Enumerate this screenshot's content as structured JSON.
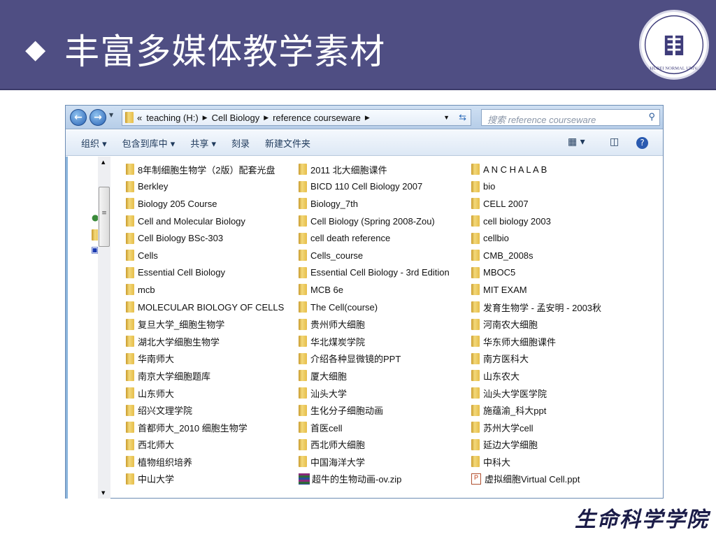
{
  "slide": {
    "bullet_icon": "diamond",
    "title": "丰富多媒体教学素材",
    "logo_text": "湖北师范学院 HUBEI NORMAL UNIVERSITY",
    "footer": "生命科学学院"
  },
  "explorer": {
    "address": [
      "«",
      "teaching (H:)",
      "Cell Biology",
      "reference courseware"
    ],
    "search_placeholder": "搜索 reference courseware",
    "toolbar": [
      "组织 ▾",
      "包含到库中 ▾",
      "共享 ▾",
      "刻录",
      "新建文件夹"
    ],
    "items": [
      {
        "name": "8年制细胞生物学（2版）配套光盘",
        "type": "folder"
      },
      {
        "name": "2011 北大细胞课件",
        "type": "folder"
      },
      {
        "name": "A N C H A   L A B",
        "type": "folder"
      },
      {
        "name": "Berkley",
        "type": "folder"
      },
      {
        "name": "BICD 110 Cell Biology 2007",
        "type": "folder"
      },
      {
        "name": "bio",
        "type": "folder"
      },
      {
        "name": "Biology 205 Course",
        "type": "folder"
      },
      {
        "name": "Biology_7th",
        "type": "folder"
      },
      {
        "name": "CELL 2007",
        "type": "folder"
      },
      {
        "name": "Cell and Molecular Biology",
        "type": "folder"
      },
      {
        "name": "Cell Biology (Spring 2008-Zou)",
        "type": "folder"
      },
      {
        "name": "cell biology 2003",
        "type": "folder"
      },
      {
        "name": "Cell Biology BSc-303",
        "type": "folder"
      },
      {
        "name": "cell death reference",
        "type": "folder"
      },
      {
        "name": "cellbio",
        "type": "folder"
      },
      {
        "name": "Cells",
        "type": "folder"
      },
      {
        "name": "Cells_course",
        "type": "folder"
      },
      {
        "name": "CMB_2008s",
        "type": "folder"
      },
      {
        "name": "Essential Cell Biology",
        "type": "folder"
      },
      {
        "name": "Essential Cell Biology - 3rd Edition",
        "type": "folder"
      },
      {
        "name": "MBOC5",
        "type": "folder"
      },
      {
        "name": "mcb",
        "type": "folder"
      },
      {
        "name": "MCB 6e",
        "type": "folder"
      },
      {
        "name": "MIT EXAM",
        "type": "folder"
      },
      {
        "name": "MOLECULAR BIOLOGY OF CELLS",
        "type": "folder"
      },
      {
        "name": "The Cell(course)",
        "type": "folder"
      },
      {
        "name": "发育生物学 - 孟安明 - 2003秋",
        "type": "folder"
      },
      {
        "name": "复旦大学_细胞生物学",
        "type": "folder"
      },
      {
        "name": "贵州师大细胞",
        "type": "folder"
      },
      {
        "name": "河南农大细胞",
        "type": "folder"
      },
      {
        "name": "湖北大学细胞生物学",
        "type": "folder"
      },
      {
        "name": "华北煤炭学院",
        "type": "folder"
      },
      {
        "name": "华东师大细胞课件",
        "type": "folder"
      },
      {
        "name": "华南师大",
        "type": "folder"
      },
      {
        "name": "介绍各种显微镜的PPT",
        "type": "folder"
      },
      {
        "name": "南方医科大",
        "type": "folder"
      },
      {
        "name": "南京大学细胞题库",
        "type": "folder"
      },
      {
        "name": "厦大细胞",
        "type": "folder"
      },
      {
        "name": "山东农大",
        "type": "folder"
      },
      {
        "name": "山东师大",
        "type": "folder"
      },
      {
        "name": "汕头大学",
        "type": "folder"
      },
      {
        "name": "汕头大学医学院",
        "type": "folder"
      },
      {
        "name": "绍兴文理学院",
        "type": "folder"
      },
      {
        "name": "生化分子细胞动画",
        "type": "folder"
      },
      {
        "name": "施蕴渝_科大ppt",
        "type": "folder"
      },
      {
        "name": "首都师大_2010 细胞生物学",
        "type": "folder"
      },
      {
        "name": "首医cell",
        "type": "folder"
      },
      {
        "name": "苏州大学cell",
        "type": "folder"
      },
      {
        "name": "西北师大",
        "type": "folder"
      },
      {
        "name": "西北师大细胞",
        "type": "folder"
      },
      {
        "name": "延边大学细胞",
        "type": "folder"
      },
      {
        "name": "植物组织培养",
        "type": "folder"
      },
      {
        "name": "中国海洋大学",
        "type": "folder"
      },
      {
        "name": "中科大",
        "type": "folder"
      },
      {
        "name": "中山大学",
        "type": "folder"
      },
      {
        "name": "超牛的生物动画-ov.zip",
        "type": "zip"
      },
      {
        "name": "虚拟细胞Virtual Cell.ppt",
        "type": "ppt"
      }
    ]
  }
}
